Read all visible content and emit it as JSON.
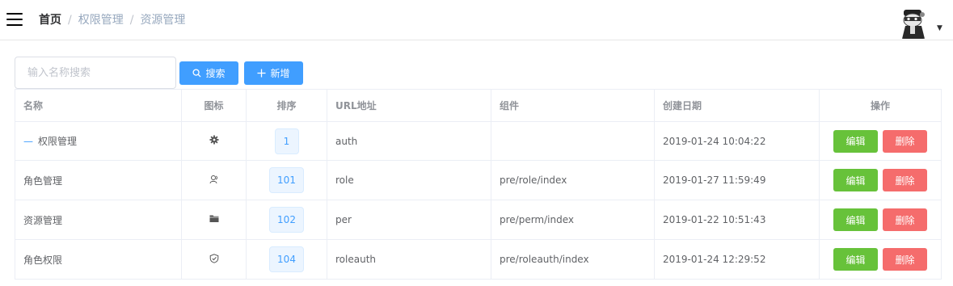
{
  "header": {
    "breadcrumb": [
      "首页",
      "权限管理",
      "资源管理"
    ],
    "breadcrumb_separator": "/",
    "avatar_caret": "▼"
  },
  "toolbar": {
    "search_placeholder": "输入名称搜索",
    "search_value": "",
    "search_label": "搜索",
    "add_label": "新增"
  },
  "table": {
    "columns": [
      "名称",
      "图标",
      "排序",
      "URL地址",
      "组件",
      "创建日期",
      "操作"
    ],
    "rows": [
      {
        "name": "权限管理",
        "icon": "gear-icon",
        "sort": "1",
        "url": "auth",
        "component": "",
        "created": "2019-01-24 10:04:22",
        "edit": "编辑",
        "delete": "删除",
        "tree_toggle": "—"
      },
      {
        "name": "角色管理",
        "icon": "user-icon",
        "sort": "101",
        "url": "role",
        "component": "pre/role/index",
        "created": "2019-01-27 11:59:49",
        "edit": "编辑",
        "delete": "删除"
      },
      {
        "name": "资源管理",
        "icon": "folder-icon",
        "sort": "102",
        "url": "per",
        "component": "pre/perm/index",
        "created": "2019-01-22 10:51:43",
        "edit": "编辑",
        "delete": "删除"
      },
      {
        "name": "角色权限",
        "icon": "shield-check-icon",
        "sort": "104",
        "url": "roleauth",
        "component": "pre/roleauth/index",
        "created": "2019-01-24 12:29:52",
        "edit": "编辑",
        "delete": "删除"
      }
    ]
  },
  "colors": {
    "primary": "#409eff",
    "success": "#67c23a",
    "danger": "#f56c6c"
  }
}
